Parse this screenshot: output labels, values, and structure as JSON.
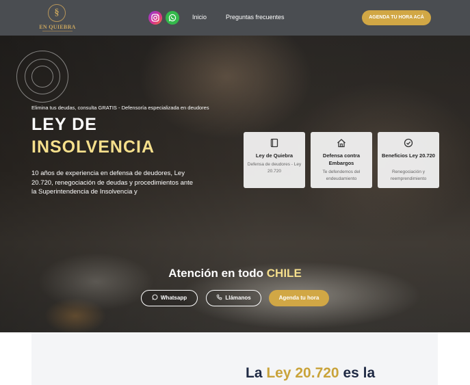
{
  "header": {
    "logo_text": "EN QUIEBRA",
    "nav": {
      "home": "Inicio",
      "faq": "Preguntas frecuentes"
    },
    "cta": "AGENDA TU HORA ACÁ"
  },
  "hero": {
    "kicker": "Elimina tus deudas, consulta GRATIS - Defensoría especializada en deudores",
    "title_line1": "LEY DE",
    "title_line2": "INSOLVENCIA",
    "description": "10 años de experiencia en defensa de deudores, Ley 20.720, renegociación de deudas y procedimientos ante la Superintendencia de Insolvencia y",
    "cards": [
      {
        "icon": "book-icon",
        "title": "Ley de Quiebra",
        "text": "Defensa de deudores - Ley 20.720"
      },
      {
        "icon": "home-icon",
        "title": "Defensa contra Embargos",
        "text": "Te defendemos del endeudamiento"
      },
      {
        "icon": "check-circle-icon",
        "title": "Beneficios Ley 20.720",
        "text": "Renegociación y reemprendimiento"
      }
    ],
    "attention_prefix": "Atención en todo",
    "attention_highlight": "CHILE",
    "buttons": {
      "whatsapp": "Whatsapp",
      "call": "Llámanos",
      "book": "Agenda tu hora"
    }
  },
  "section": {
    "heading_prefix": "La",
    "heading_highlight": "Ley 20.720",
    "heading_suffix": "es la"
  },
  "colors": {
    "header_bg": "#4a4d51",
    "accent_gold": "#d1a745",
    "title_highlight": "#f5df8c",
    "instagram": "#d9338a",
    "whatsapp": "#34b94b",
    "heading_navy": "#1f2a44"
  }
}
